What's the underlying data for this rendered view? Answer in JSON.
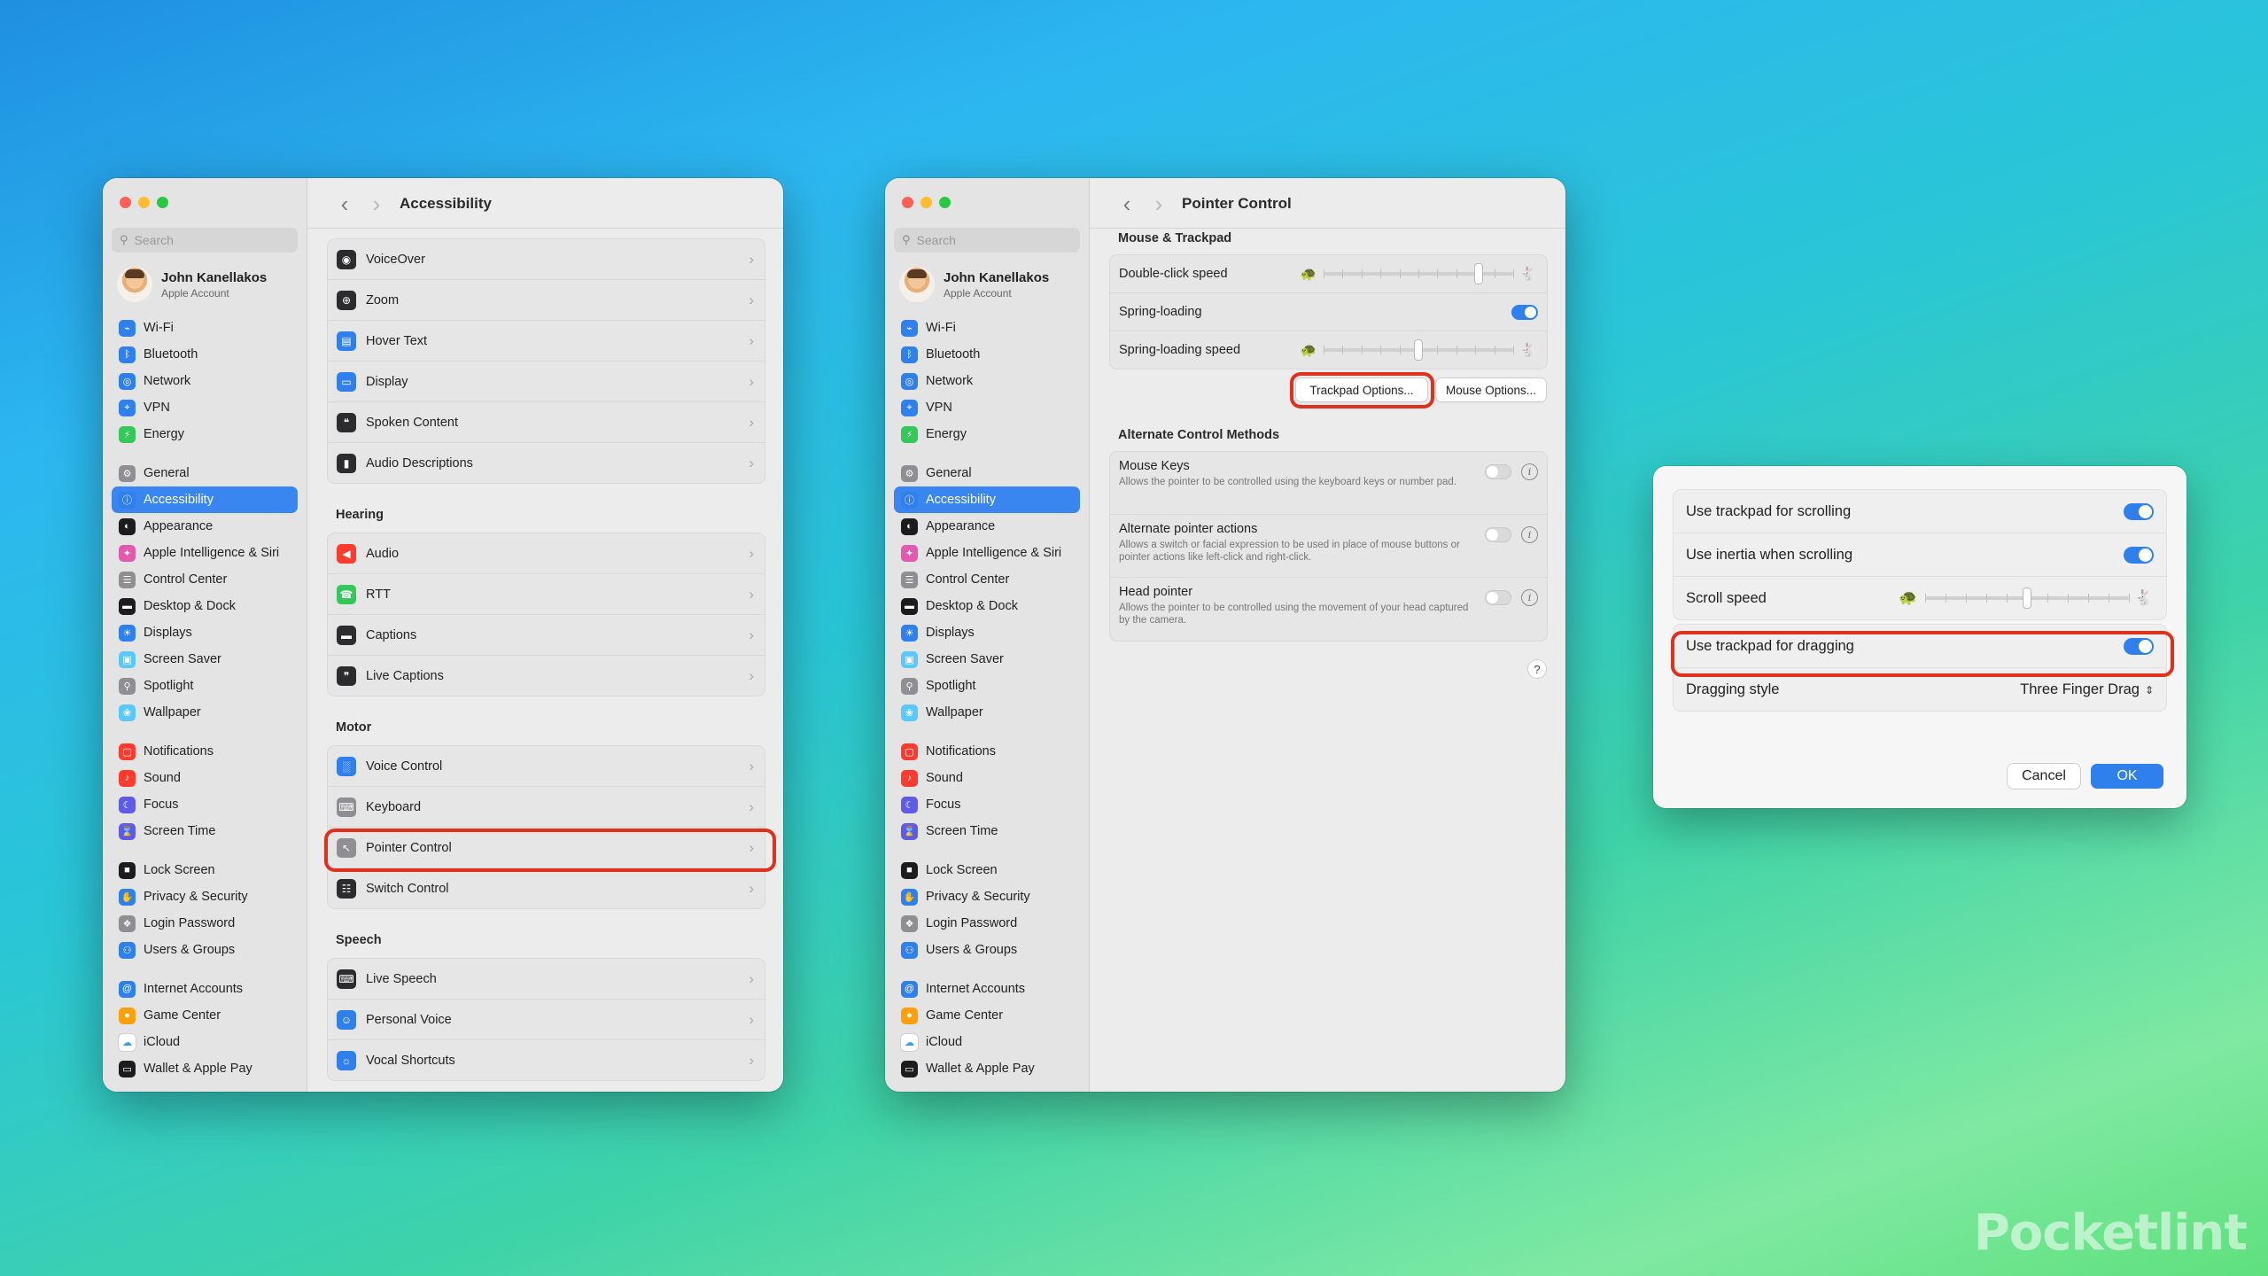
{
  "window1": {
    "search_placeholder": "Search",
    "user": {
      "name": "John Kanellakos",
      "subtitle": "Apple Account"
    },
    "page_title": "Accessibility",
    "sections": [
      {
        "title": "",
        "items": [
          {
            "label": "VoiceOver",
            "icon": "voiceover-icon"
          },
          {
            "label": "Zoom",
            "icon": "zoom-icon"
          },
          {
            "label": "Hover Text",
            "icon": "hover-text-icon"
          },
          {
            "label": "Display",
            "icon": "display-icon"
          },
          {
            "label": "Spoken Content",
            "icon": "spoken-content-icon"
          },
          {
            "label": "Audio Descriptions",
            "icon": "audio-descriptions-icon"
          }
        ]
      },
      {
        "title": "Hearing",
        "items": [
          {
            "label": "Audio",
            "icon": "audio-icon"
          },
          {
            "label": "RTT",
            "icon": "rtt-icon"
          },
          {
            "label": "Captions",
            "icon": "captions-icon"
          },
          {
            "label": "Live Captions",
            "icon": "live-captions-icon"
          }
        ]
      },
      {
        "title": "Motor",
        "items": [
          {
            "label": "Voice Control",
            "icon": "voice-control-icon"
          },
          {
            "label": "Keyboard",
            "icon": "keyboard-icon"
          },
          {
            "label": "Pointer Control",
            "icon": "pointer-control-icon"
          },
          {
            "label": "Switch Control",
            "icon": "switch-control-icon"
          }
        ]
      },
      {
        "title": "Speech",
        "items": [
          {
            "label": "Live Speech",
            "icon": "live-speech-icon"
          },
          {
            "label": "Personal Voice",
            "icon": "personal-voice-icon"
          },
          {
            "label": "Vocal Shortcuts",
            "icon": "vocal-shortcuts-icon"
          }
        ]
      }
    ]
  },
  "sidebar": {
    "groups": [
      [
        {
          "label": "Wi-Fi",
          "icon": "wifi-icon",
          "color": "#2f80ed"
        },
        {
          "label": "Bluetooth",
          "icon": "bluetooth-icon",
          "color": "#2f80ed"
        },
        {
          "label": "Network",
          "icon": "network-icon",
          "color": "#2f80ed"
        },
        {
          "label": "VPN",
          "icon": "vpn-icon",
          "color": "#2f80ed"
        },
        {
          "label": "Energy",
          "icon": "energy-icon",
          "color": "#34c759"
        }
      ],
      [
        {
          "label": "General",
          "icon": "general-icon",
          "color": "#8e8e93"
        },
        {
          "label": "Accessibility",
          "icon": "accessibility-icon",
          "color": "#2f80ed",
          "selected": true
        },
        {
          "label": "Appearance",
          "icon": "appearance-icon",
          "color": "#1c1c1e"
        },
        {
          "label": "Apple Intelligence & Siri",
          "icon": "siri-icon",
          "color": "#e25ab0"
        },
        {
          "label": "Control Center",
          "icon": "control-center-icon",
          "color": "#8e8e93"
        },
        {
          "label": "Desktop & Dock",
          "icon": "desktop-dock-icon",
          "color": "#1c1c1e"
        },
        {
          "label": "Displays",
          "icon": "displays-icon",
          "color": "#2f80ed"
        },
        {
          "label": "Screen Saver",
          "icon": "screen-saver-icon",
          "color": "#5ac8fa"
        },
        {
          "label": "Spotlight",
          "icon": "spotlight-icon",
          "color": "#8e8e93"
        },
        {
          "label": "Wallpaper",
          "icon": "wallpaper-icon",
          "color": "#5ac8fa"
        }
      ],
      [
        {
          "label": "Notifications",
          "icon": "notifications-icon",
          "color": "#ff3b30"
        },
        {
          "label": "Sound",
          "icon": "sound-icon",
          "color": "#ff3b30"
        },
        {
          "label": "Focus",
          "icon": "focus-icon",
          "color": "#5e5ce6"
        },
        {
          "label": "Screen Time",
          "icon": "screen-time-icon",
          "color": "#5e5ce6"
        }
      ],
      [
        {
          "label": "Lock Screen",
          "icon": "lock-screen-icon",
          "color": "#1c1c1e"
        },
        {
          "label": "Privacy & Security",
          "icon": "privacy-icon",
          "color": "#2f80ed"
        },
        {
          "label": "Login Password",
          "icon": "login-password-icon",
          "color": "#8e8e93"
        },
        {
          "label": "Users & Groups",
          "icon": "users-groups-icon",
          "color": "#2f80ed"
        }
      ],
      [
        {
          "label": "Internet Accounts",
          "icon": "internet-accounts-icon",
          "color": "#2f80ed"
        },
        {
          "label": "Game Center",
          "icon": "game-center-icon",
          "color": "#ff9f0a"
        },
        {
          "label": "iCloud",
          "icon": "icloud-icon",
          "color": "#ffffff"
        },
        {
          "label": "Wallet & Apple Pay",
          "icon": "wallet-icon",
          "color": "#1c1c1e"
        }
      ]
    ]
  },
  "window2": {
    "search_placeholder": "Search",
    "user": {
      "name": "John Kanellakos",
      "subtitle": "Apple Account"
    },
    "page_title": "Pointer Control",
    "mouse_trackpad": {
      "title": "Mouse & Trackpad",
      "double_click_speed": {
        "label": "Double-click speed",
        "value": 0.82
      },
      "spring_loading": {
        "label": "Spring-loading",
        "on": true
      },
      "spring_loading_speed": {
        "label": "Spring-loading speed",
        "value": 0.5
      },
      "trackpad_options": "Trackpad Options...",
      "mouse_options": "Mouse Options..."
    },
    "alternate": {
      "title": "Alternate Control Methods",
      "items": [
        {
          "label": "Mouse Keys",
          "desc": "Allows the pointer to be controlled using the keyboard keys or number pad.",
          "on": false
        },
        {
          "label": "Alternate pointer actions",
          "desc": "Allows a switch or facial expression to be used in place of mouse buttons or pointer actions like left-click and right-click.",
          "on": false
        },
        {
          "label": "Head pointer",
          "desc": "Allows the pointer to be controlled using the movement of your head captured by the camera.",
          "on": false
        }
      ]
    },
    "help": "?"
  },
  "dialog": {
    "scrolling": {
      "label": "Use trackpad for scrolling",
      "on": true
    },
    "inertia": {
      "label": "Use inertia when scrolling",
      "on": true
    },
    "scroll_speed": {
      "label": "Scroll speed",
      "value": 0.5
    },
    "dragging": {
      "label": "Use trackpad for dragging",
      "on": true
    },
    "dragging_style": {
      "label": "Dragging style",
      "value": "Three Finger Drag"
    },
    "cancel": "Cancel",
    "ok": "OK"
  },
  "watermark": "Pocketlint",
  "colors": {
    "accent": "#2f80ed",
    "highlight": "#e0301e"
  }
}
